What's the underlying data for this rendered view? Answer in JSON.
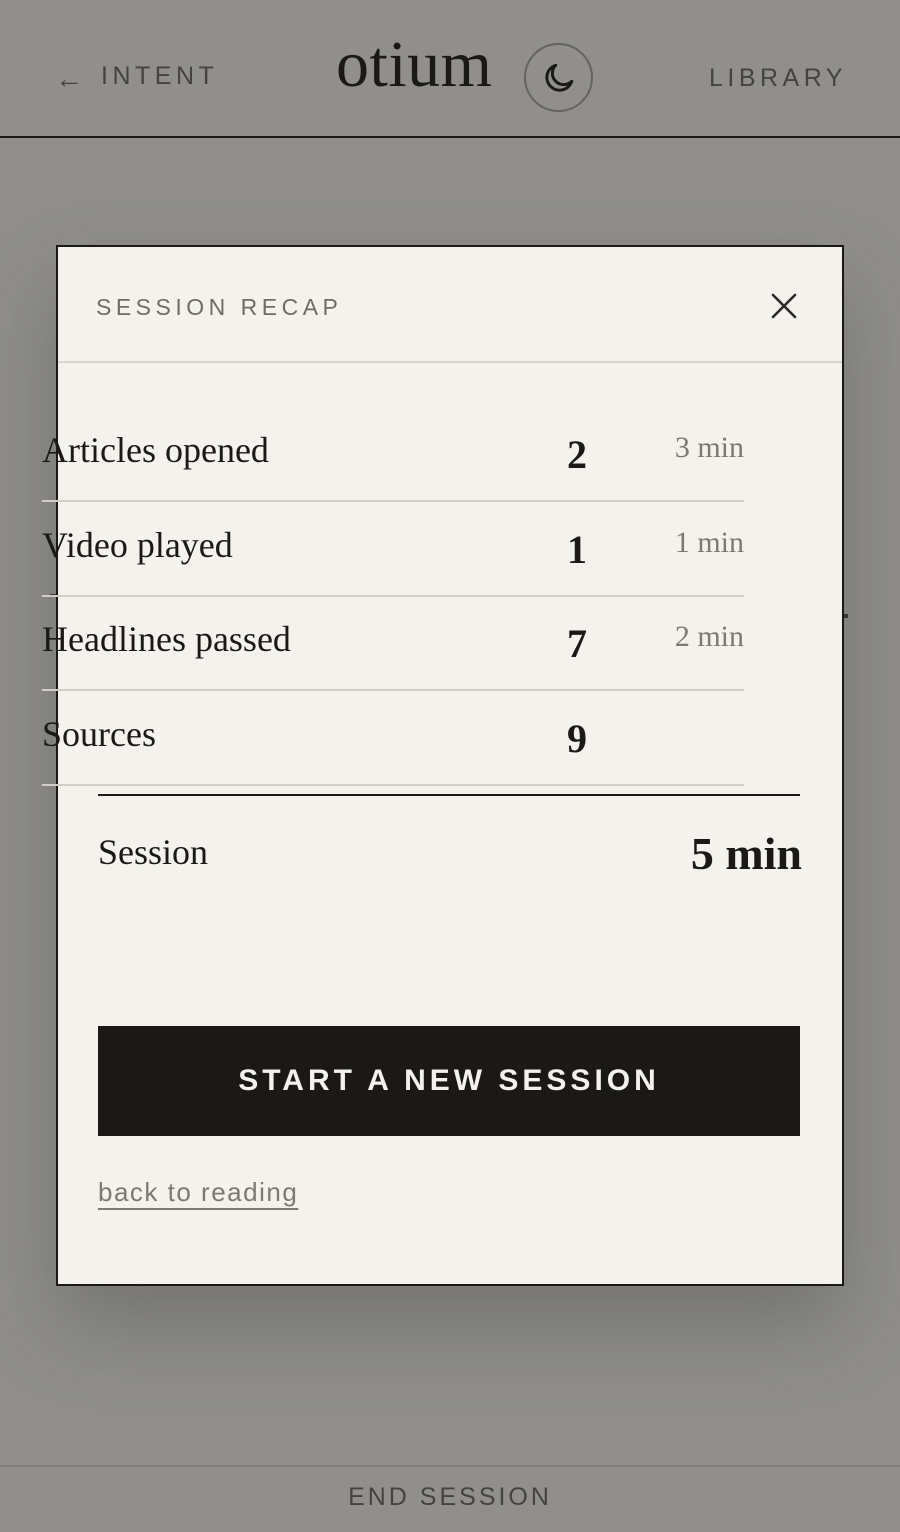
{
  "header": {
    "back_arrow": "←",
    "back_label": "INTENT",
    "brand": "otium",
    "theme_toggle_icon": "moon-icon",
    "library_label": "LIBRARY"
  },
  "modal": {
    "title": "SESSION RECAP",
    "close_icon": "close-icon",
    "rows": [
      {
        "label": "Articles opened",
        "count": "2",
        "time": "3 min"
      },
      {
        "label": "Video played",
        "count": "1",
        "time": "1 min"
      },
      {
        "label": "Headlines passed",
        "count": "7",
        "time": "2 min"
      },
      {
        "label": "Sources",
        "count": "9",
        "time": ""
      }
    ],
    "total": {
      "label": "Session",
      "value": "5 min"
    },
    "primary_button": "START A NEW SESSION",
    "back_link": "back to reading"
  },
  "footer": {
    "end_session": "END SESSION"
  },
  "colors": {
    "ink": "#1b1915",
    "paper": "#f3f2ec",
    "muted": "#7c7973",
    "overlay": "#908f8b"
  }
}
